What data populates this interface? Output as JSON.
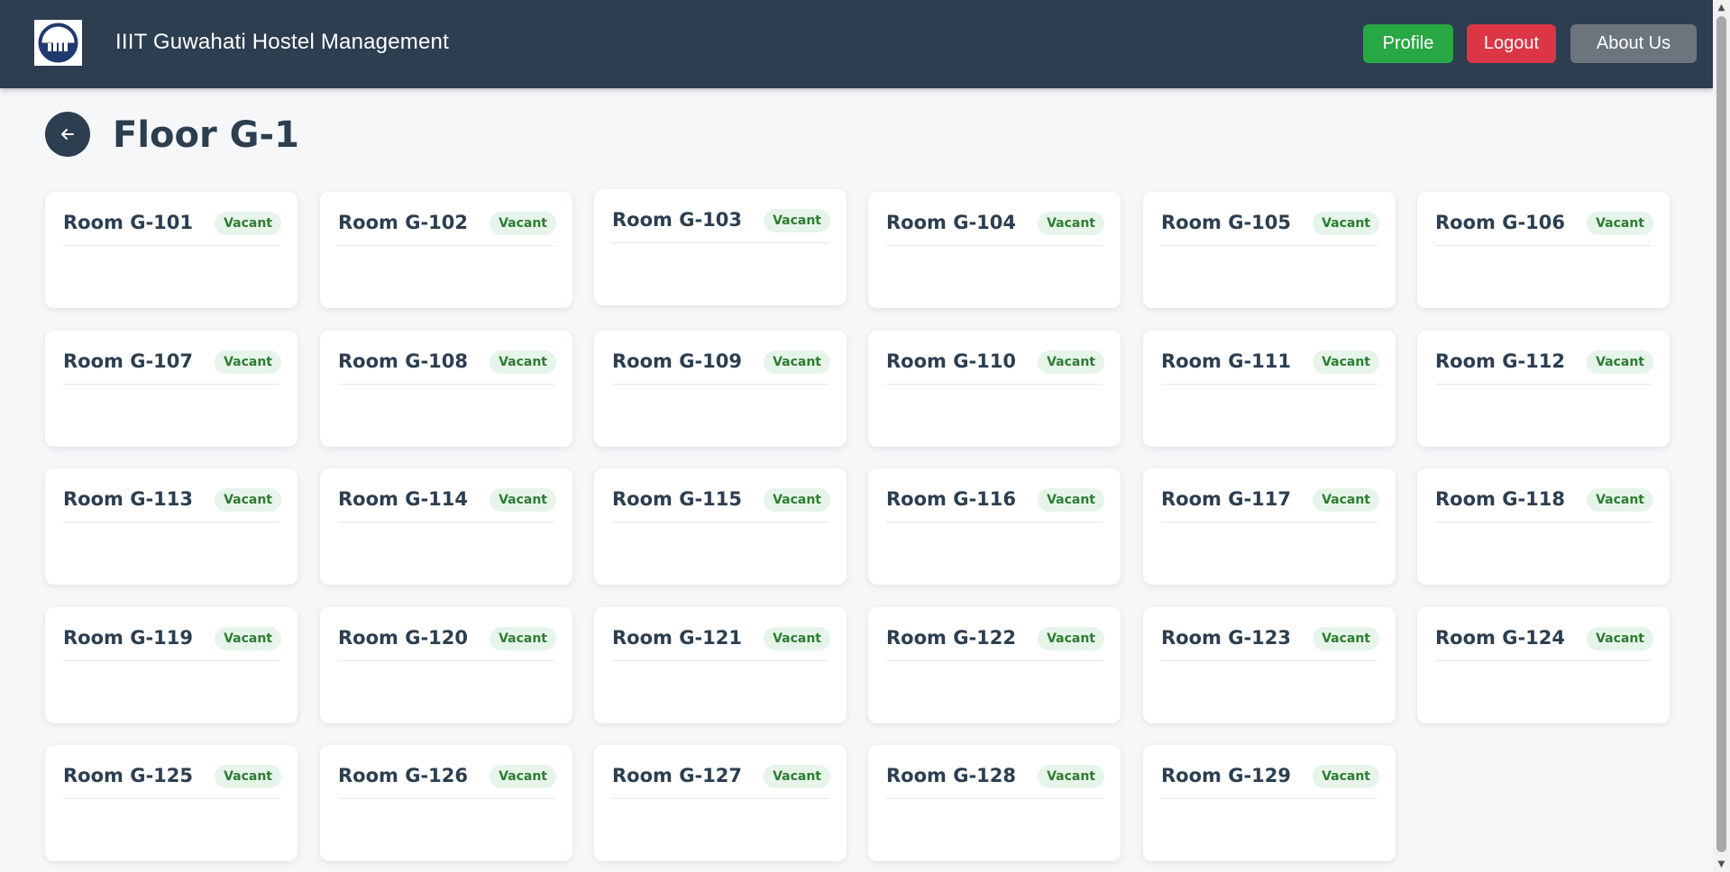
{
  "header": {
    "brand": "IIIT Guwahati Hostel Management",
    "profile_label": "Profile",
    "logout_label": "Logout",
    "about_label": "About Us",
    "colors": {
      "navbar": "#2c3e50",
      "profile": "#28a745",
      "logout": "#dc3545",
      "about": "#6c757d"
    }
  },
  "page": {
    "title": "Floor G-1",
    "back_icon": "arrow-left-icon"
  },
  "rooms": [
    {
      "name": "Room G-101",
      "status": "Vacant"
    },
    {
      "name": "Room G-102",
      "status": "Vacant"
    },
    {
      "name": "Room G-103",
      "status": "Vacant"
    },
    {
      "name": "Room G-104",
      "status": "Vacant"
    },
    {
      "name": "Room G-105",
      "status": "Vacant"
    },
    {
      "name": "Room G-106",
      "status": "Vacant"
    },
    {
      "name": "Room G-107",
      "status": "Vacant"
    },
    {
      "name": "Room G-108",
      "status": "Vacant"
    },
    {
      "name": "Room G-109",
      "status": "Vacant"
    },
    {
      "name": "Room G-110",
      "status": "Vacant"
    },
    {
      "name": "Room G-111",
      "status": "Vacant"
    },
    {
      "name": "Room G-112",
      "status": "Vacant"
    },
    {
      "name": "Room G-113",
      "status": "Vacant"
    },
    {
      "name": "Room G-114",
      "status": "Vacant"
    },
    {
      "name": "Room G-115",
      "status": "Vacant"
    },
    {
      "name": "Room G-116",
      "status": "Vacant"
    },
    {
      "name": "Room G-117",
      "status": "Vacant"
    },
    {
      "name": "Room G-118",
      "status": "Vacant"
    },
    {
      "name": "Room G-119",
      "status": "Vacant"
    },
    {
      "name": "Room G-120",
      "status": "Vacant"
    },
    {
      "name": "Room G-121",
      "status": "Vacant"
    },
    {
      "name": "Room G-122",
      "status": "Vacant"
    },
    {
      "name": "Room G-123",
      "status": "Vacant"
    },
    {
      "name": "Room G-124",
      "status": "Vacant"
    },
    {
      "name": "Room G-125",
      "status": "Vacant"
    },
    {
      "name": "Room G-126",
      "status": "Vacant"
    },
    {
      "name": "Room G-127",
      "status": "Vacant"
    },
    {
      "name": "Room G-128",
      "status": "Vacant"
    },
    {
      "name": "Room G-129",
      "status": "Vacant"
    }
  ],
  "status_colors": {
    "vacant_bg": "#e6f4ea",
    "vacant_text": "#2e7d32"
  }
}
